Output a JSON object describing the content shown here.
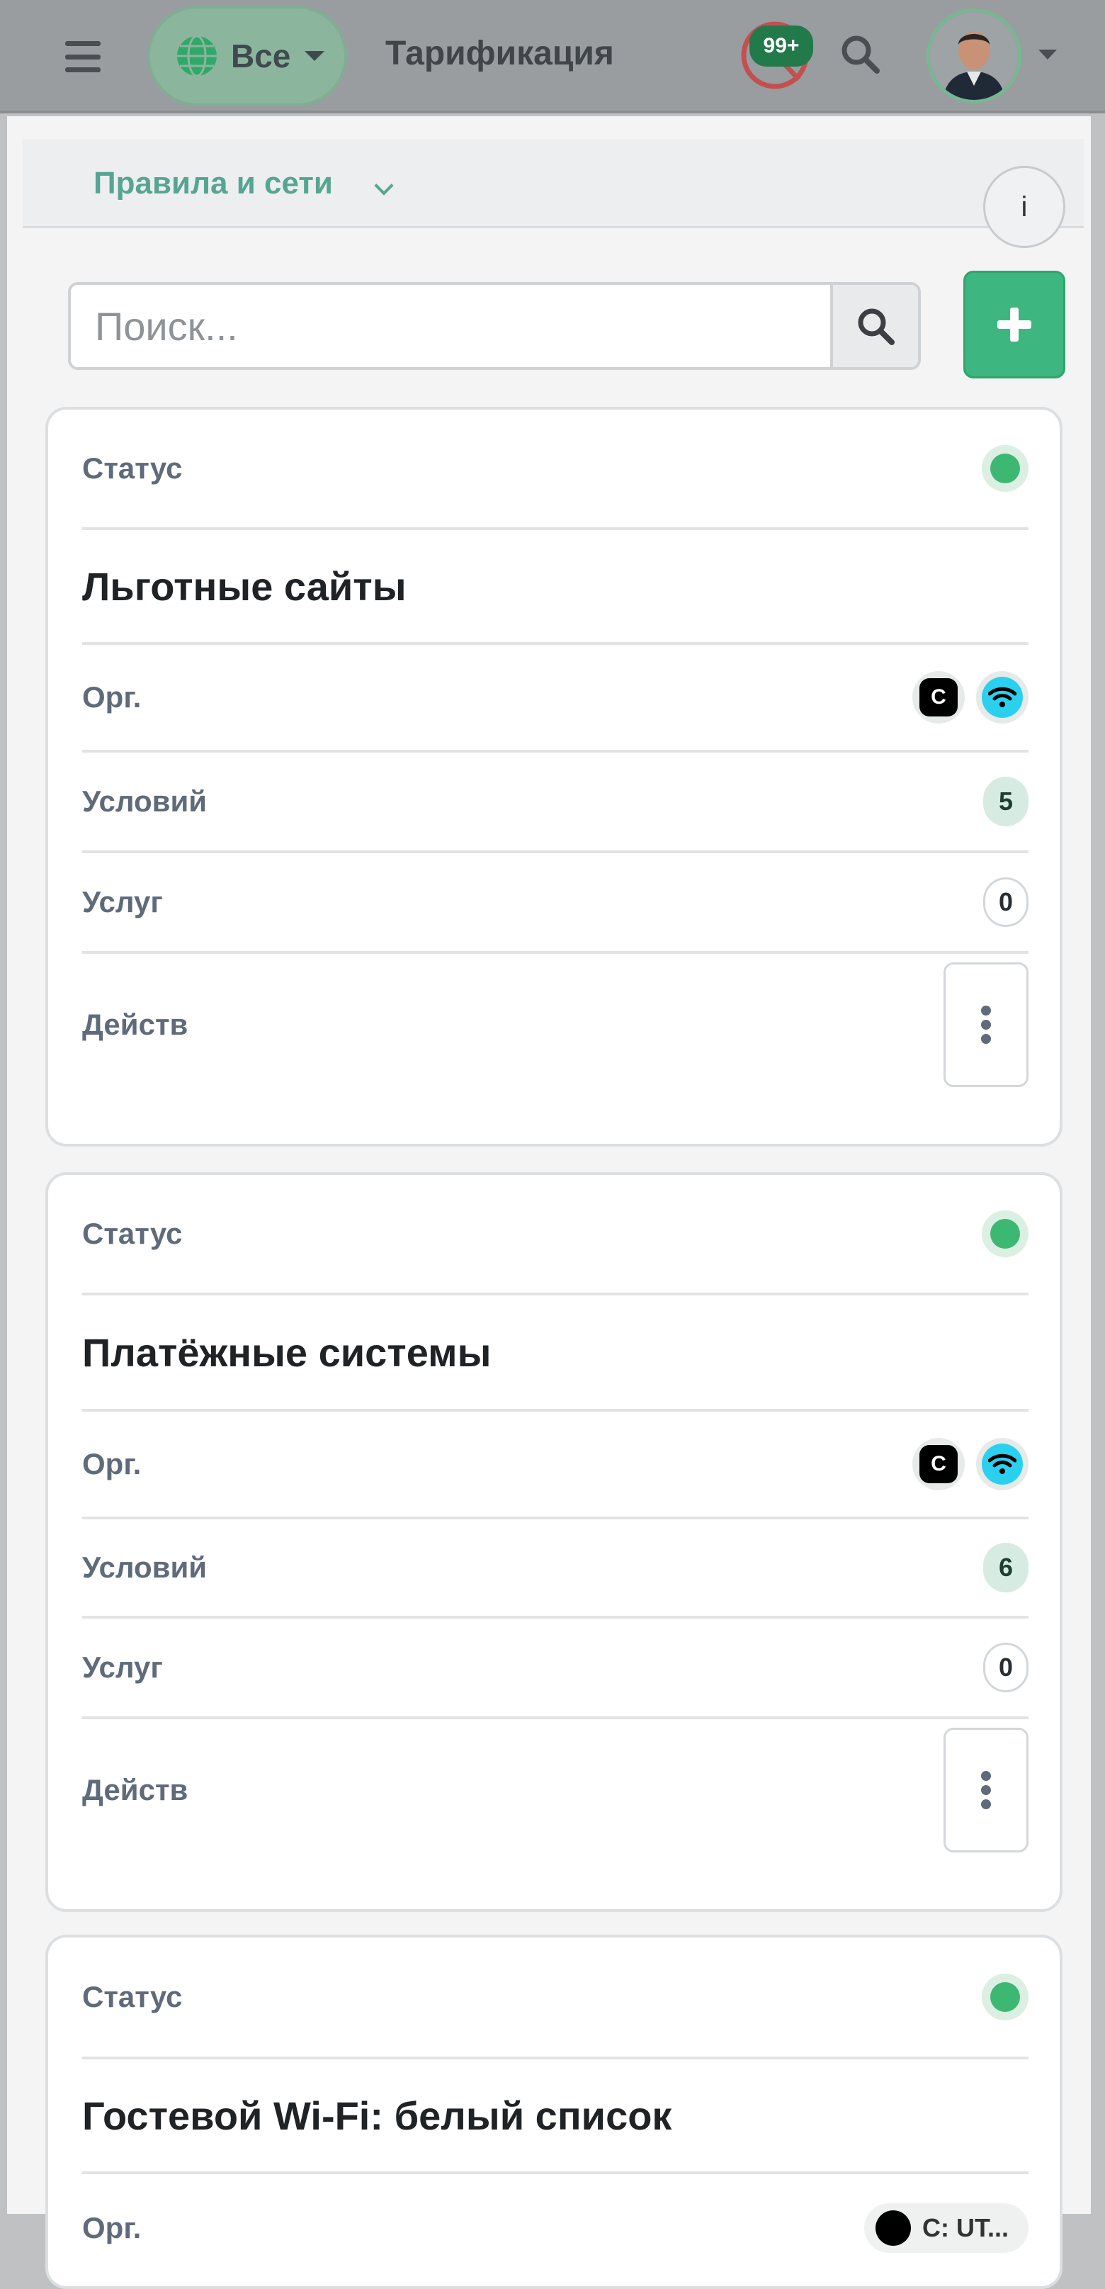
{
  "topbar": {
    "scope_label": "Все",
    "title": "Тарификация",
    "notifications_count": "99+"
  },
  "subheader": {
    "section_title": "Правила и сети",
    "info_label": "i"
  },
  "search": {
    "placeholder": "Поиск..."
  },
  "labels": {
    "status": "Статус",
    "org": "Орг.",
    "conditions": "Условий",
    "services": "Услуг",
    "actions": "Действ"
  },
  "cards": [
    {
      "name": "Льготные сайты",
      "org_badge_c": "C",
      "conditions": "5",
      "services": "0"
    },
    {
      "name": "Платёжные системы",
      "org_badge_c": "C",
      "conditions": "6",
      "services": "0"
    },
    {
      "name": "Гостевой Wi-Fi: белый список",
      "org_pill_text": "C: UT..."
    }
  ],
  "colors": {
    "accent": "#3db77f",
    "status_active": "#3db872",
    "section_title": "#56a592"
  }
}
